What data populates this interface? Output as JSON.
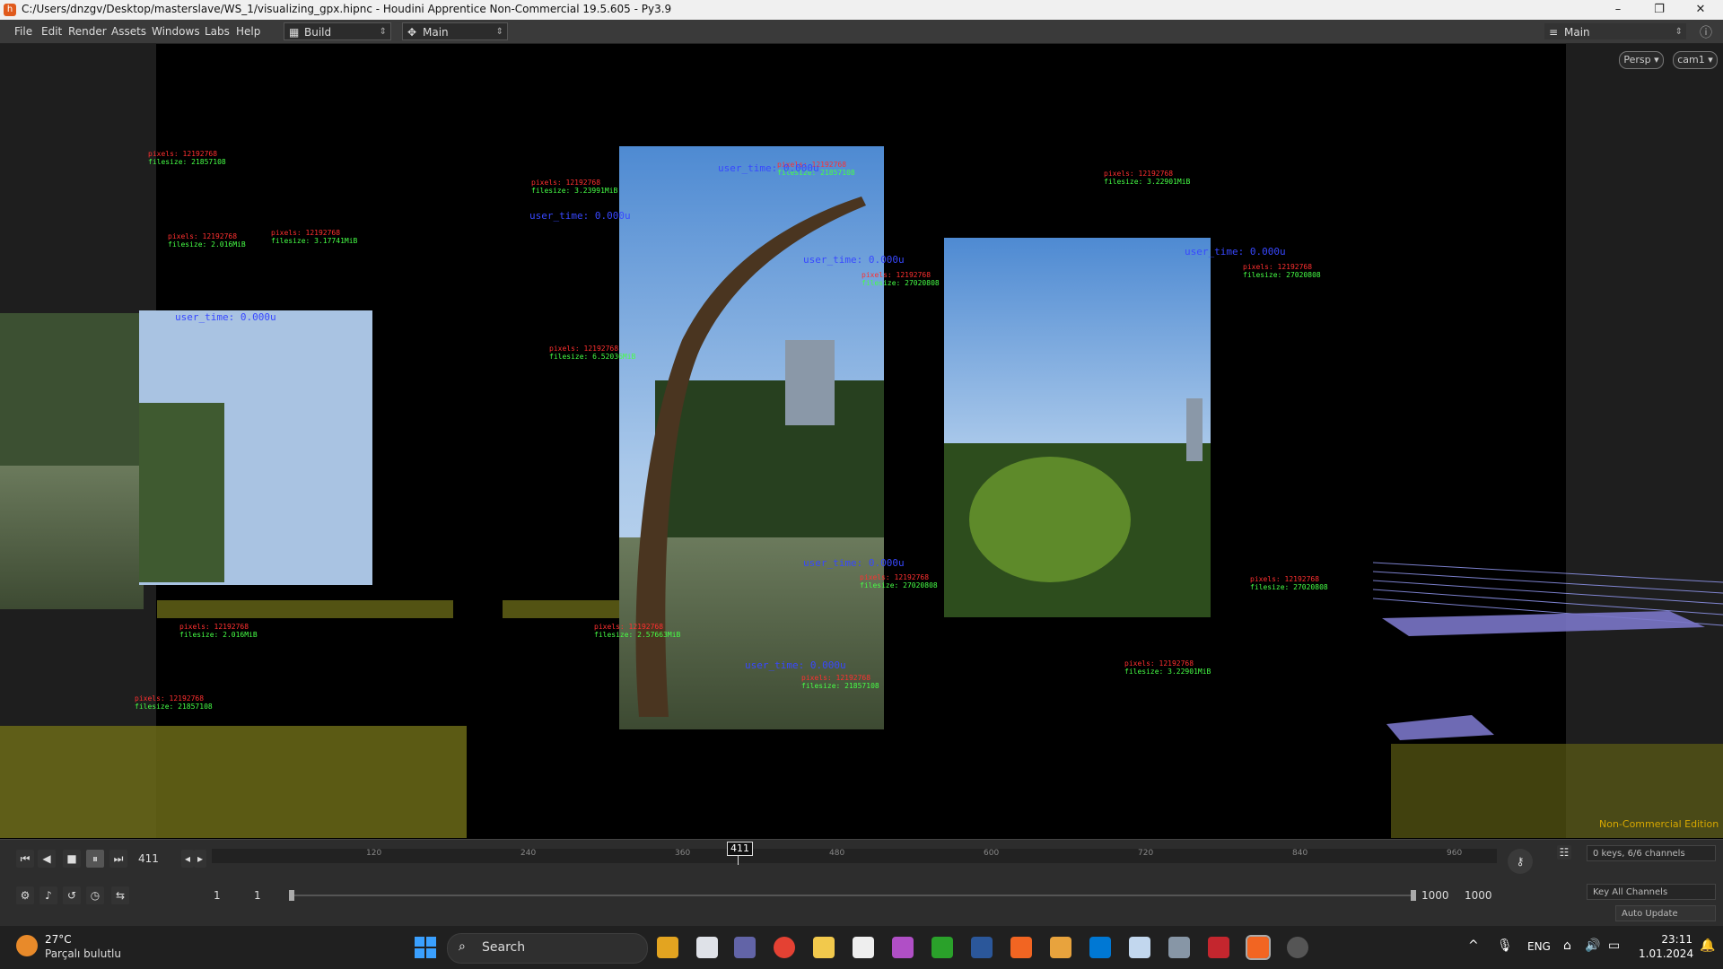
{
  "window": {
    "title": "C:/Users/dnzgv/Desktop/masterslave/WS_1/visualizing_gpx.hipnc - Houdini Apprentice Non-Commercial 19.5.605 - Py3.9",
    "minimize": "–",
    "restore": "❐",
    "close": "✕"
  },
  "menubar": {
    "items": [
      "File",
      "Edit",
      "Render",
      "Assets",
      "Windows",
      "Labs",
      "Help"
    ],
    "desktop_build": "Build",
    "desktop_main": "Main",
    "desktop_main_right": "Main"
  },
  "viewport": {
    "persp_label": "Persp ▾",
    "cam_label": "cam1 ▾",
    "watermark": "Non-Commercial Edition",
    "attr_labels": [
      {
        "p": "pixels: 12192768",
        "f": "filesize: 21857108"
      },
      {
        "p": "pixels: 12192768",
        "f": "filesize: 3.23991MiB"
      },
      {
        "p": "pixels: 12192768",
        "f": "filesize: 21857108"
      },
      {
        "p": "pixels: 12192768",
        "f": "filesize: 3.22901MiB"
      },
      {
        "p": "pixels: 12192768",
        "f": "filesize: 27020808"
      },
      {
        "p": "pixels: 12192768",
        "f": "filesize: 27020808"
      },
      {
        "p": "pixels: 12192768",
        "f": "filesize: 2.016MiB"
      },
      {
        "p": "pixels: 12192768",
        "f": "filesize: 3.17741MiB"
      },
      {
        "p": "pixels: 12192768",
        "f": "filesize: 6.52036MiB"
      },
      {
        "p": "pixels: 12192768",
        "f": "filesize: 2.57663MiB"
      },
      {
        "p": "pixels: 12192768",
        "f": "filesize: 21857108"
      },
      {
        "p": "pixels: 12192768",
        "f": "filesize: 3.22901MiB"
      },
      {
        "p": "pixels: 12192768",
        "f": "filesize: 27020808"
      },
      {
        "p": "pixels: 12192768",
        "f": "filesize: 27020808"
      },
      {
        "p": "pixels: 12192768",
        "f": "filesize: 2.016MiB"
      },
      {
        "p": "pixels: 12192768",
        "f": "filesize: 21857108"
      }
    ],
    "blue_labels": [
      "user_time: 0.000u",
      "user_time: 0.000u",
      "user_time: 0.000u",
      "user_time: 0.000u",
      "user_time: 0.000u",
      "user_time: 0.000u",
      "user_time: 0.000u"
    ]
  },
  "timeline": {
    "current_frame": "411",
    "ticks": [
      "120",
      "240",
      "360",
      "480",
      "600",
      "720",
      "840",
      "960"
    ],
    "marker": "411",
    "range_start": "1",
    "range_start2": "1",
    "range_end": "1000",
    "range_end2": "1000",
    "keys_info": "0 keys, 6/6 channels",
    "key_all": "Key All Channels",
    "auto_update": "Auto Update"
  },
  "taskbar": {
    "weather_temp": "27°C",
    "weather_desc": "Parçalı bulutlu",
    "search_placeholder": "Search",
    "language": "ENG",
    "time": "23:11",
    "date": "1.01.2024"
  }
}
